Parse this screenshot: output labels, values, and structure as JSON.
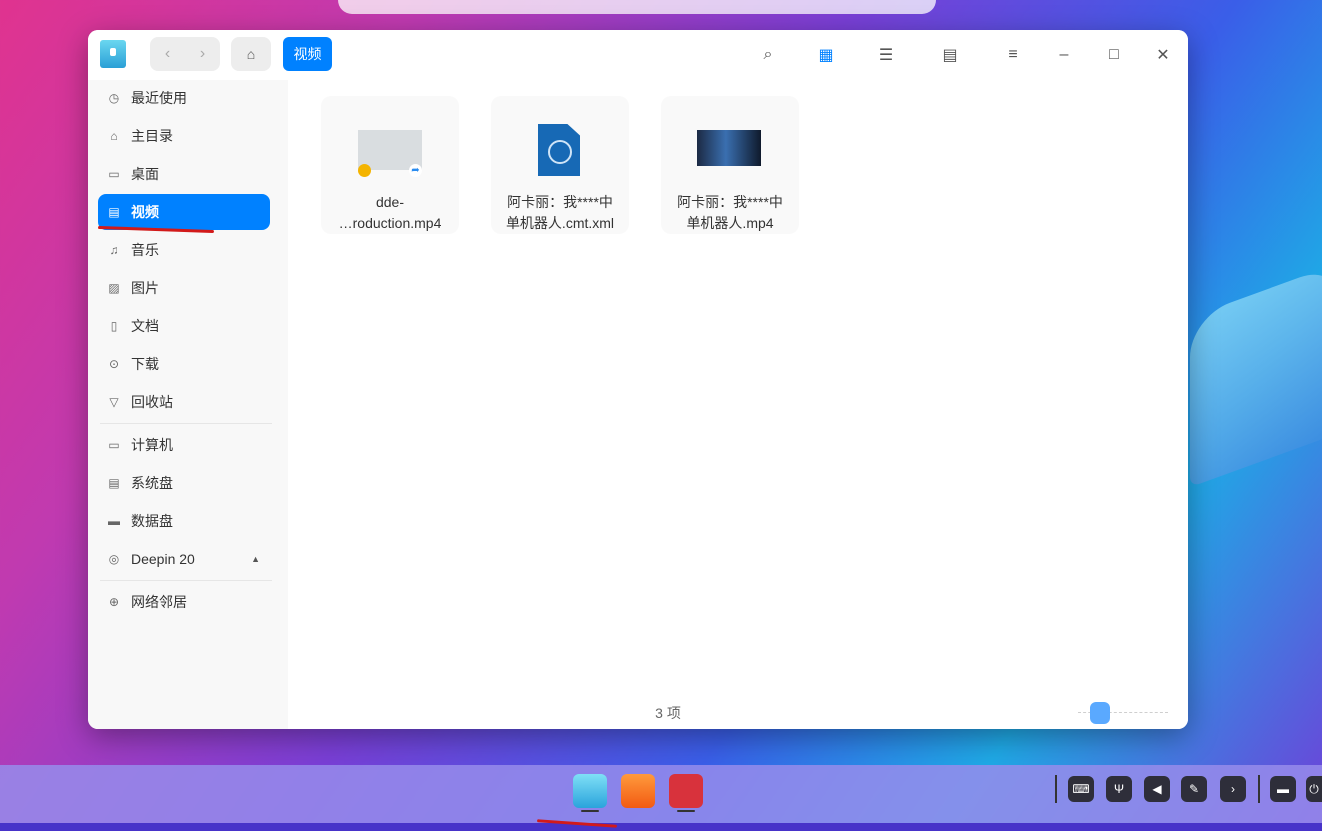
{
  "window": {
    "breadcrumb": "视频"
  },
  "titlebar_icons": [
    "search-icon",
    "icon-view-icon",
    "list-view-icon",
    "detail-view-icon",
    "menu-icon",
    "minimize-icon",
    "maximize-icon",
    "close-icon"
  ],
  "sidebar": {
    "items": [
      {
        "label": "最近使用",
        "icon": "clock-icon",
        "glyph": "◷"
      },
      {
        "label": "主目录",
        "icon": "home-icon",
        "glyph": "⌂"
      },
      {
        "label": "桌面",
        "icon": "desktop-icon",
        "glyph": "▭"
      },
      {
        "label": "视频",
        "icon": "video-icon",
        "glyph": "▤",
        "active": true
      },
      {
        "label": "音乐",
        "icon": "music-icon",
        "glyph": "♫"
      },
      {
        "label": "图片",
        "icon": "picture-icon",
        "glyph": "▨"
      },
      {
        "label": "文档",
        "icon": "document-icon",
        "glyph": "▯"
      },
      {
        "label": "下载",
        "icon": "download-icon",
        "glyph": "⊙"
      },
      {
        "label": "回收站",
        "icon": "trash-icon",
        "glyph": "▽"
      }
    ],
    "devices": [
      {
        "label": "计算机",
        "icon": "computer-icon",
        "glyph": "▭"
      },
      {
        "label": "系统盘",
        "icon": "disk-icon",
        "glyph": "▤"
      },
      {
        "label": "数据盘",
        "icon": "disk-icon",
        "glyph": "▬"
      },
      {
        "label": "Deepin 20",
        "icon": "optical-disc-icon",
        "glyph": "◎"
      }
    ],
    "network": {
      "label": "网络邻居",
      "icon": "network-icon",
      "glyph": "⊕"
    }
  },
  "files": [
    {
      "name": "dde-\n…roduction.mp4"
    },
    {
      "name": "阿卡丽：我****中\n单机器人.cmt.xml"
    },
    {
      "name": "阿卡丽：我****中\n单机器人.mp4"
    }
  ],
  "status": {
    "count": "3 项"
  },
  "colors": {
    "accent": "#0081ff"
  }
}
